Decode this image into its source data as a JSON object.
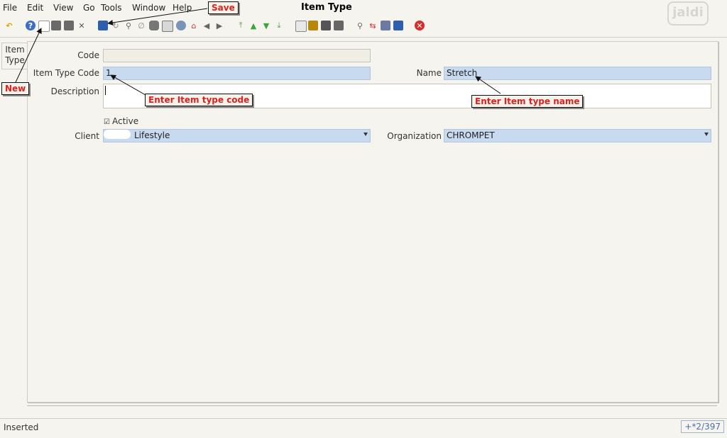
{
  "menu": {
    "file": "File",
    "edit": "Edit",
    "view": "View",
    "go": "Go",
    "tools": "Tools",
    "window": "Window",
    "help": "Help"
  },
  "window_title": "Item Type",
  "logo_text": "jaldi",
  "side_tab": {
    "line1": "Item",
    "line2": "Type"
  },
  "form": {
    "code_label": "Code",
    "code_value": "",
    "item_type_code_label": "Item Type Code",
    "item_type_code_value": "1",
    "name_label": "Name",
    "name_value": "Stretch",
    "description_label": "Description",
    "description_value": "",
    "active_label": "Active",
    "client_label": "Client",
    "client_value": "Lifestyle",
    "organization_label": "Organization",
    "organization_value": "CHROMPET"
  },
  "annotations": {
    "save": "Save",
    "new": "New",
    "enter_code": "Enter Item type code",
    "enter_name": "Enter Item type name"
  },
  "status": {
    "text": "Inserted",
    "record": "+*2/397"
  },
  "colors": {
    "mandatory_field": "#c7daf0",
    "callout_text": "#e0201e"
  }
}
